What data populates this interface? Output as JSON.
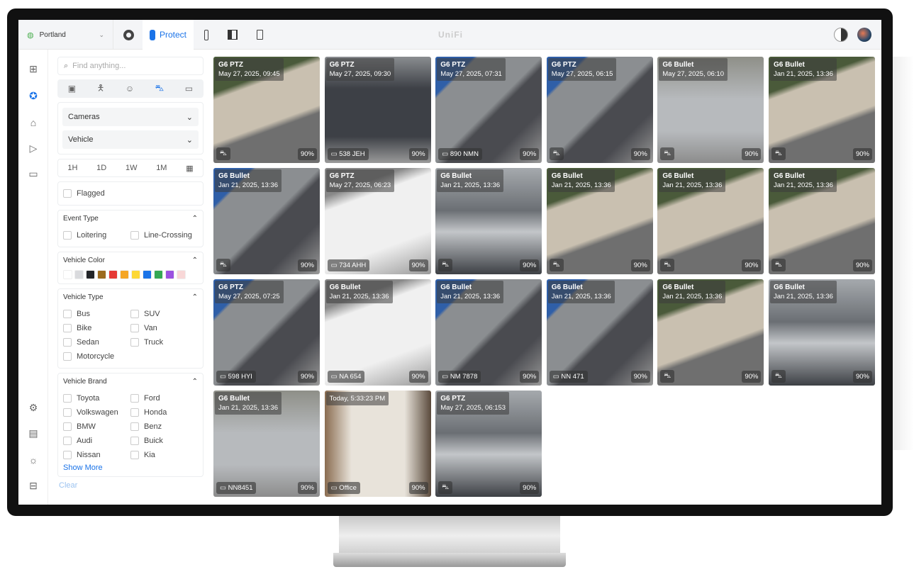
{
  "topbar": {
    "site": "Portland",
    "app": "Protect",
    "logo": "UniFi"
  },
  "search": {
    "placeholder": "Find anything..."
  },
  "filters": {
    "cameras": "Cameras",
    "vehicle": "Vehicle",
    "time": [
      "1H",
      "1D",
      "1W",
      "1M"
    ],
    "flagged": "Flagged",
    "event_type": {
      "title": "Event Type",
      "items": [
        "Loitering",
        "Line-Crossing"
      ]
    },
    "vehicle_color": {
      "title": "Vehicle Color",
      "colors": [
        "#ffffff",
        "#d9dadd",
        "#222428",
        "#9c6b1e",
        "#e53935",
        "#f5a623",
        "#fdd835",
        "#1a73e8",
        "#34a853",
        "#9b51e0",
        "#f8d7d7"
      ]
    },
    "vehicle_type": {
      "title": "Vehicle Type",
      "items": [
        "Bus",
        "SUV",
        "Bike",
        "Van",
        "Sedan",
        "Truck",
        "Motorcycle"
      ]
    },
    "vehicle_brand": {
      "title": "Vehicle Brand",
      "items": [
        "Toyota",
        "Ford",
        "Volkswagen",
        "Honda",
        "BMW",
        "Benz",
        "Audi",
        "Buick",
        "Nissan",
        "Kia"
      ],
      "show_more": "Show More"
    },
    "clear": "Clear"
  },
  "events": [
    {
      "camera": "G6 PTZ",
      "time": "May 27, 2025, 09:45",
      "tag": "",
      "conf": "90%",
      "scene": "truck"
    },
    {
      "camera": "G6 PTZ",
      "time": "May 27, 2025, 09:30",
      "tag": "538 JEH",
      "conf": "90%",
      "scene": "suv"
    },
    {
      "camera": "G6 PTZ",
      "time": "May 27, 2025, 07:31",
      "tag": "890 NMN",
      "conf": "90%",
      "scene": "car"
    },
    {
      "camera": "G6 PTZ",
      "time": "May 27, 2025, 06:15",
      "tag": "",
      "conf": "90%",
      "scene": "car"
    },
    {
      "camera": "G6 Bullet",
      "time": "May 27, 2025, 06:10",
      "tag": "",
      "conf": "90%",
      "scene": "wagon"
    },
    {
      "camera": "G6 Bullet",
      "time": "Jan 21, 2025, 13:36",
      "tag": "",
      "conf": "90%",
      "scene": "truck"
    },
    {
      "camera": "G6 Bullet",
      "time": "Jan 21, 2025, 13:36",
      "tag": "",
      "conf": "90%",
      "scene": "car"
    },
    {
      "camera": "G6 PTZ",
      "time": "May 27, 2025, 06:23",
      "tag": "734 AHH",
      "conf": "90%",
      "scene": "white"
    },
    {
      "camera": "G6 Bullet",
      "time": "Jan 21, 2025, 13:36",
      "tag": "",
      "conf": "90%",
      "scene": "lot"
    },
    {
      "camera": "G6 Bullet",
      "time": "Jan 21, 2025, 13:36",
      "tag": "",
      "conf": "90%",
      "scene": "truck"
    },
    {
      "camera": "G6 Bullet",
      "time": "Jan 21, 2025, 13:36",
      "tag": "",
      "conf": "90%",
      "scene": "truck"
    },
    {
      "camera": "G6 Bullet",
      "time": "Jan 21, 2025, 13:36",
      "tag": "",
      "conf": "90%",
      "scene": "truck"
    },
    {
      "camera": "G6 PTZ",
      "time": "May 27, 2025, 07:25",
      "tag": "598 HYI",
      "conf": "90%",
      "scene": "car"
    },
    {
      "camera": "G6 Bullet",
      "time": "Jan 21, 2025, 13:36",
      "tag": "NA 654",
      "conf": "90%",
      "scene": "white"
    },
    {
      "camera": "G6 Bullet",
      "time": "Jan 21, 2025, 13:36",
      "tag": "NM 7878",
      "conf": "90%",
      "scene": "car"
    },
    {
      "camera": "G6 Bullet",
      "time": "Jan 21, 2025, 13:36",
      "tag": "NN 471",
      "conf": "90%",
      "scene": "car"
    },
    {
      "camera": "G6 Bullet",
      "time": "Jan 21, 2025, 13:36",
      "tag": "",
      "conf": "90%",
      "scene": "truck"
    },
    {
      "camera": "G6 Bullet",
      "time": "Jan 21, 2025, 13:36",
      "tag": "",
      "conf": "90%",
      "scene": "lot"
    },
    {
      "camera": "G6 Bullet",
      "time": "Jan 21, 2025, 13:36",
      "tag": "NN8451",
      "conf": "90%",
      "scene": "wagon"
    },
    {
      "camera": "",
      "time": "Today, 5:33:23 PM",
      "tag": "Office",
      "conf": "90%",
      "scene": "amb"
    },
    {
      "camera": "G6 PTZ",
      "time": "May 27, 2025, 06:153",
      "tag": "",
      "conf": "90%",
      "scene": "lot"
    }
  ]
}
